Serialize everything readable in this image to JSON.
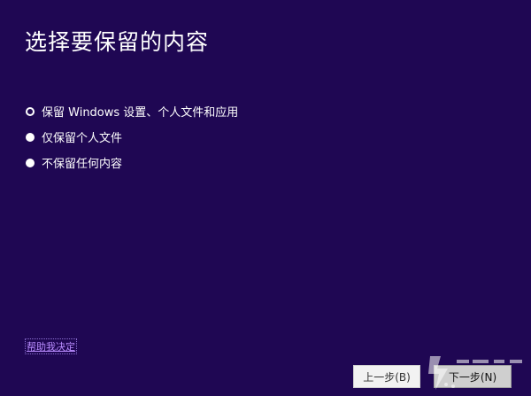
{
  "page": {
    "title": "选择要保留的内容"
  },
  "options": [
    {
      "label": "保留 Windows 设置、个人文件和应用",
      "selected": true
    },
    {
      "label": "仅保留个人文件",
      "selected": false
    },
    {
      "label": "不保留任何内容",
      "selected": false
    }
  ],
  "help_link": "帮助我决定",
  "buttons": {
    "back": "上一步(B)",
    "next": "下一步(N)"
  },
  "colors": {
    "background": "#1f0753",
    "link": "#b98cff"
  }
}
